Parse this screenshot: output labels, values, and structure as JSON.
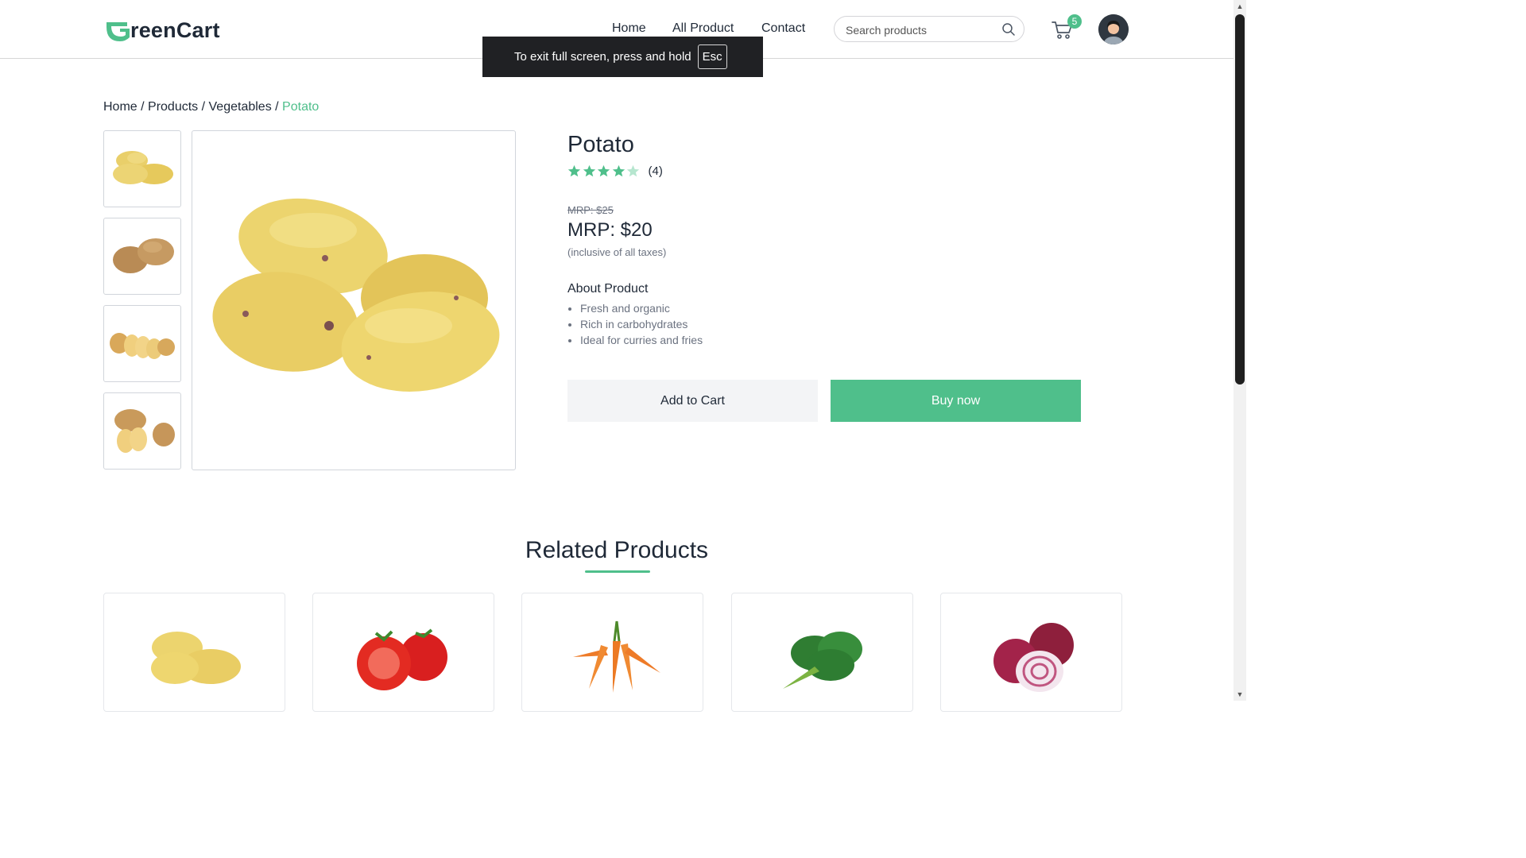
{
  "header": {
    "logo_text": "reenCart",
    "nav": [
      "Home",
      "All Product",
      "Contact"
    ],
    "search_placeholder": "Search products",
    "cart_count": "5"
  },
  "toast": {
    "message": "To exit full screen, press and hold",
    "key": "Esc"
  },
  "breadcrumb": {
    "home": "Home",
    "products": "Products",
    "category": "Vegetables",
    "current": "Potato",
    "sep": " / "
  },
  "product": {
    "name": "Potato",
    "rating": 4,
    "rating_max": 5,
    "review_count": "(4)",
    "old_price": "MRP: $25",
    "price": "MRP: $20",
    "tax_note": "(inclusive of all taxes)",
    "about_heading": "About Product",
    "about_items": [
      "Fresh and organic",
      "Rich in carbohydrates",
      "Ideal for curries and fries"
    ],
    "add_to_cart": "Add to Cart",
    "buy_now": "Buy now"
  },
  "related": {
    "heading": "Related Products",
    "items": [
      "potato",
      "tomato",
      "carrot",
      "spinach",
      "onion"
    ]
  },
  "colors": {
    "accent": "#4fbf8b",
    "text": "#1f2937",
    "muted": "#6b7280"
  }
}
